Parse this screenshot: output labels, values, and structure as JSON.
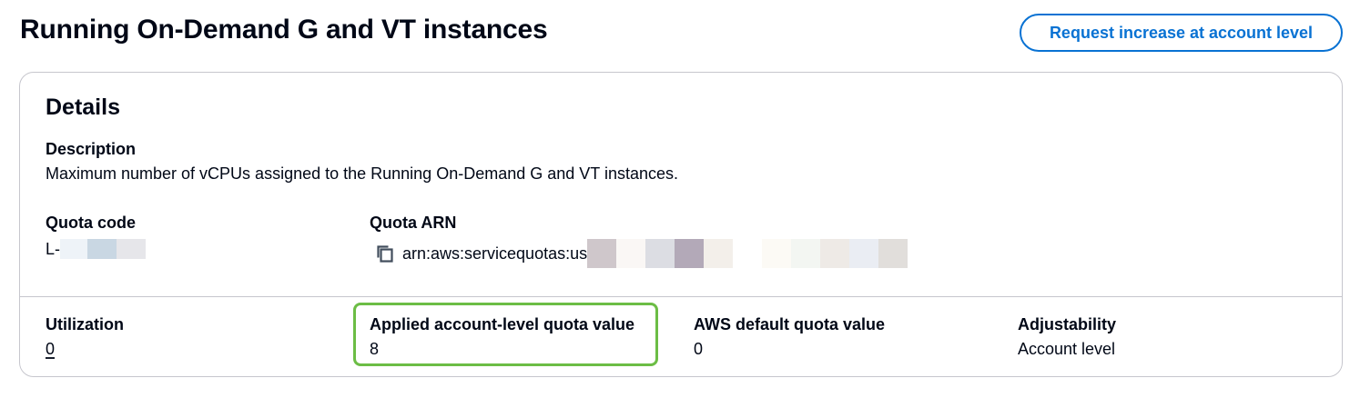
{
  "header": {
    "title": "Running On-Demand G and VT instances",
    "request_button_label": "Request increase at account level"
  },
  "details": {
    "title": "Details",
    "description": {
      "label": "Description",
      "value": "Maximum number of vCPUs assigned to the Running On-Demand G and VT instances."
    },
    "quota_code": {
      "label": "Quota code",
      "value_prefix": "L-",
      "redaction_colors": [
        "#eef3f8",
        "#c9d7e3",
        "#e6e6ea"
      ]
    },
    "quota_arn": {
      "label": "Quota ARN",
      "value_prefix": "arn:aws:servicequotas:us",
      "copy_icon": "copy-icon",
      "redaction_colors": [
        "#cfc7cb",
        "#faf7f5",
        "#dcdde3",
        "#b3a9b8",
        "#f3efea",
        "#ffffff",
        "#fcfaf5",
        "#f3f6f2",
        "#eeeae6",
        "#eaedf3",
        "#e1dedb"
      ]
    },
    "utilization": {
      "label": "Utilization",
      "value": "0"
    },
    "applied_quota": {
      "label": "Applied account-level quota value",
      "value": "8",
      "highlight_color": "#6cbd45"
    },
    "default_quota": {
      "label": "AWS default quota value",
      "value": "0"
    },
    "adjustability": {
      "label": "Adjustability",
      "value": "Account level"
    }
  },
  "colors": {
    "accent": "#0972d3",
    "text": "#000716",
    "border": "#c6c6cd"
  }
}
